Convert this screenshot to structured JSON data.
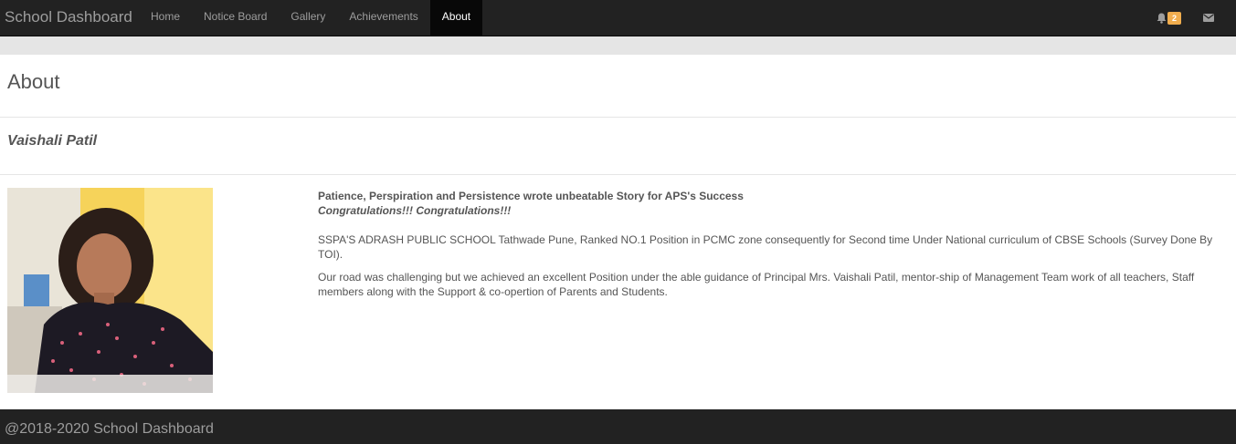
{
  "navbar": {
    "brand": "School Dashboard",
    "items": [
      {
        "label": "Home"
      },
      {
        "label": "Notice Board"
      },
      {
        "label": "Gallery"
      },
      {
        "label": "Achievements"
      },
      {
        "label": "About",
        "active": true
      }
    ],
    "notification_count": "2",
    "icons": [
      "bell-icon",
      "envelope-icon"
    ]
  },
  "page": {
    "title": "About",
    "person_name": "Vaishali Patil"
  },
  "content": {
    "headline": "Patience, Perspiration and Persistence wrote unbeatable Story for APS's Success",
    "congrats": "Congratulations!!! Congratulations!!!",
    "paragraph1": "SSPA'S ADRASH PUBLIC SCHOOL Tathwade Pune, Ranked NO.1 Position in PCMC zone consequently for Second time Under National curriculum of CBSE Schools (Survey Done By TOI).",
    "paragraph2": "Our road was challenging but we achieved an excellent Position under the able guidance of Principal Mrs. Vaishali Patil, mentor-ship of Management Team work of all teachers, Staff members along with the Support & co-opertion of Parents and Students."
  },
  "footer": {
    "text": "@2018-2020 School Dashboard"
  },
  "colors": {
    "navbar_bg": "#222222",
    "active_bg": "#080808",
    "badge": "#f0ad4e",
    "photo_bg": "#f6d35a"
  }
}
